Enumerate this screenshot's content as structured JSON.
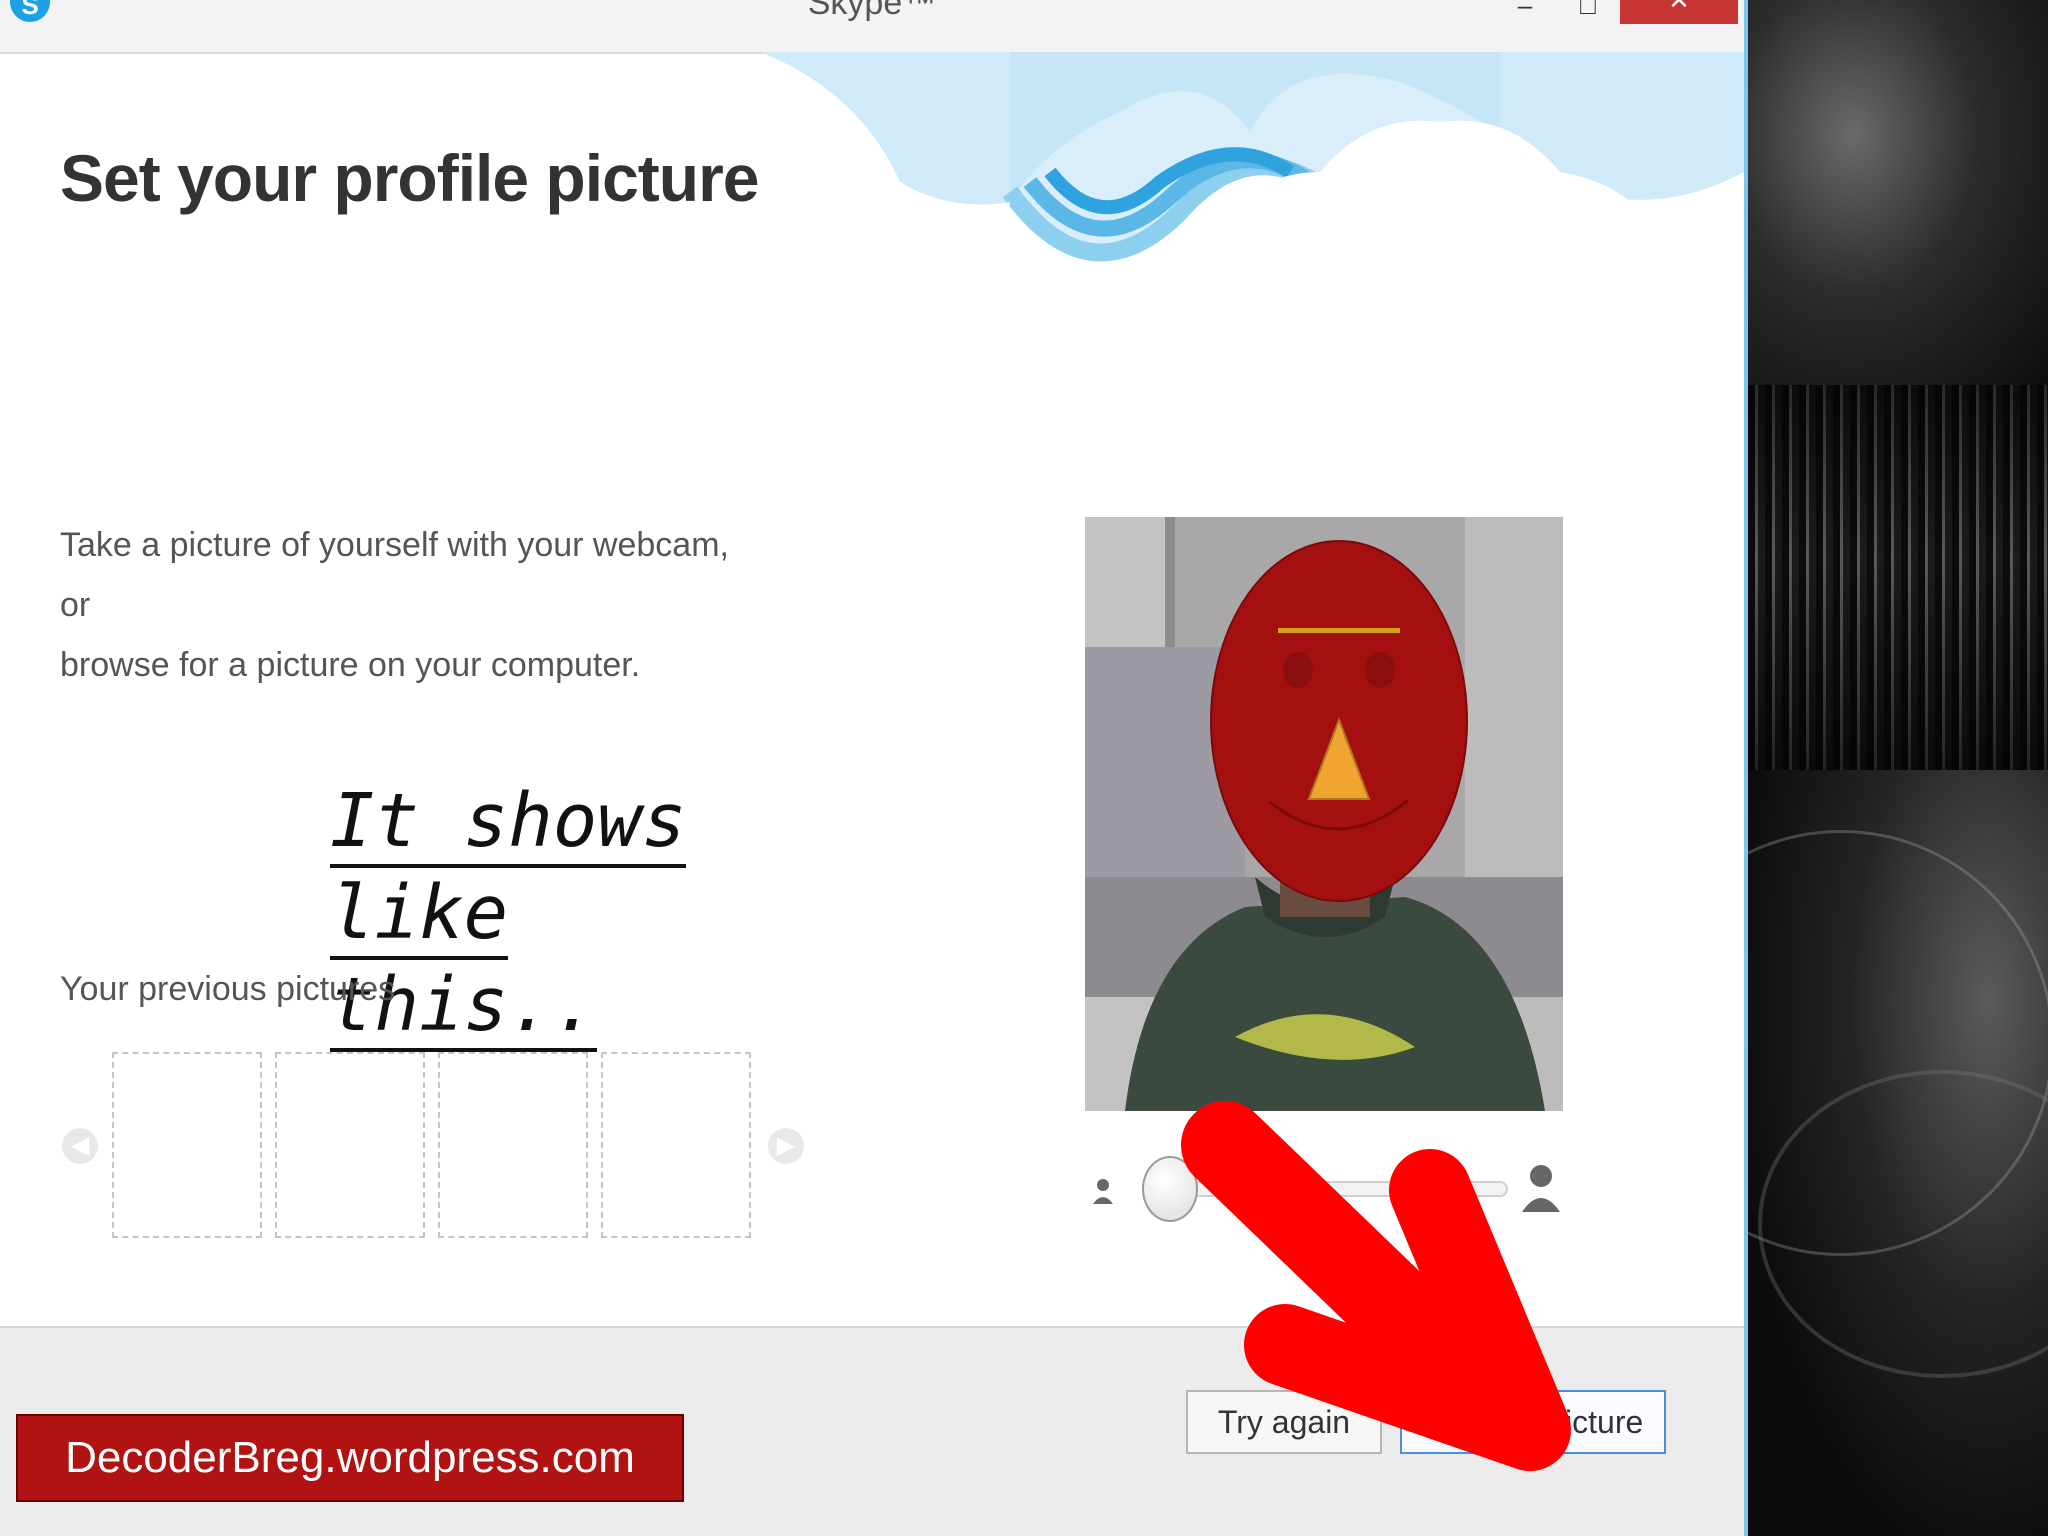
{
  "window": {
    "title": "Skype™",
    "app_icon_letter": "S",
    "controls": {
      "minimize": "‒",
      "maximize": "□",
      "close": "✕"
    }
  },
  "main": {
    "heading": "Set your profile picture",
    "description_line1": "Take a picture of yourself with your webcam, or",
    "description_line2": "browse for a picture on your computer.",
    "previous_label": "Your previous pictures",
    "prev_arrow": "◀",
    "next_arrow": "▶"
  },
  "annotation": {
    "line1": "It shows like",
    "line2": "this.."
  },
  "zoom": {
    "level": 0,
    "small_icon": "person-small-icon",
    "large_icon": "person-large-icon"
  },
  "footer": {
    "try_again": "Try again",
    "use_picture": "Use this picture"
  },
  "watermark": "DecoderBreg.wordpress.com",
  "colors": {
    "accent": "#4a90d9",
    "arrow": "#ff0000",
    "mask_face": "#a41010",
    "watermark_bg": "#b11212",
    "close_button": "#c73434"
  }
}
